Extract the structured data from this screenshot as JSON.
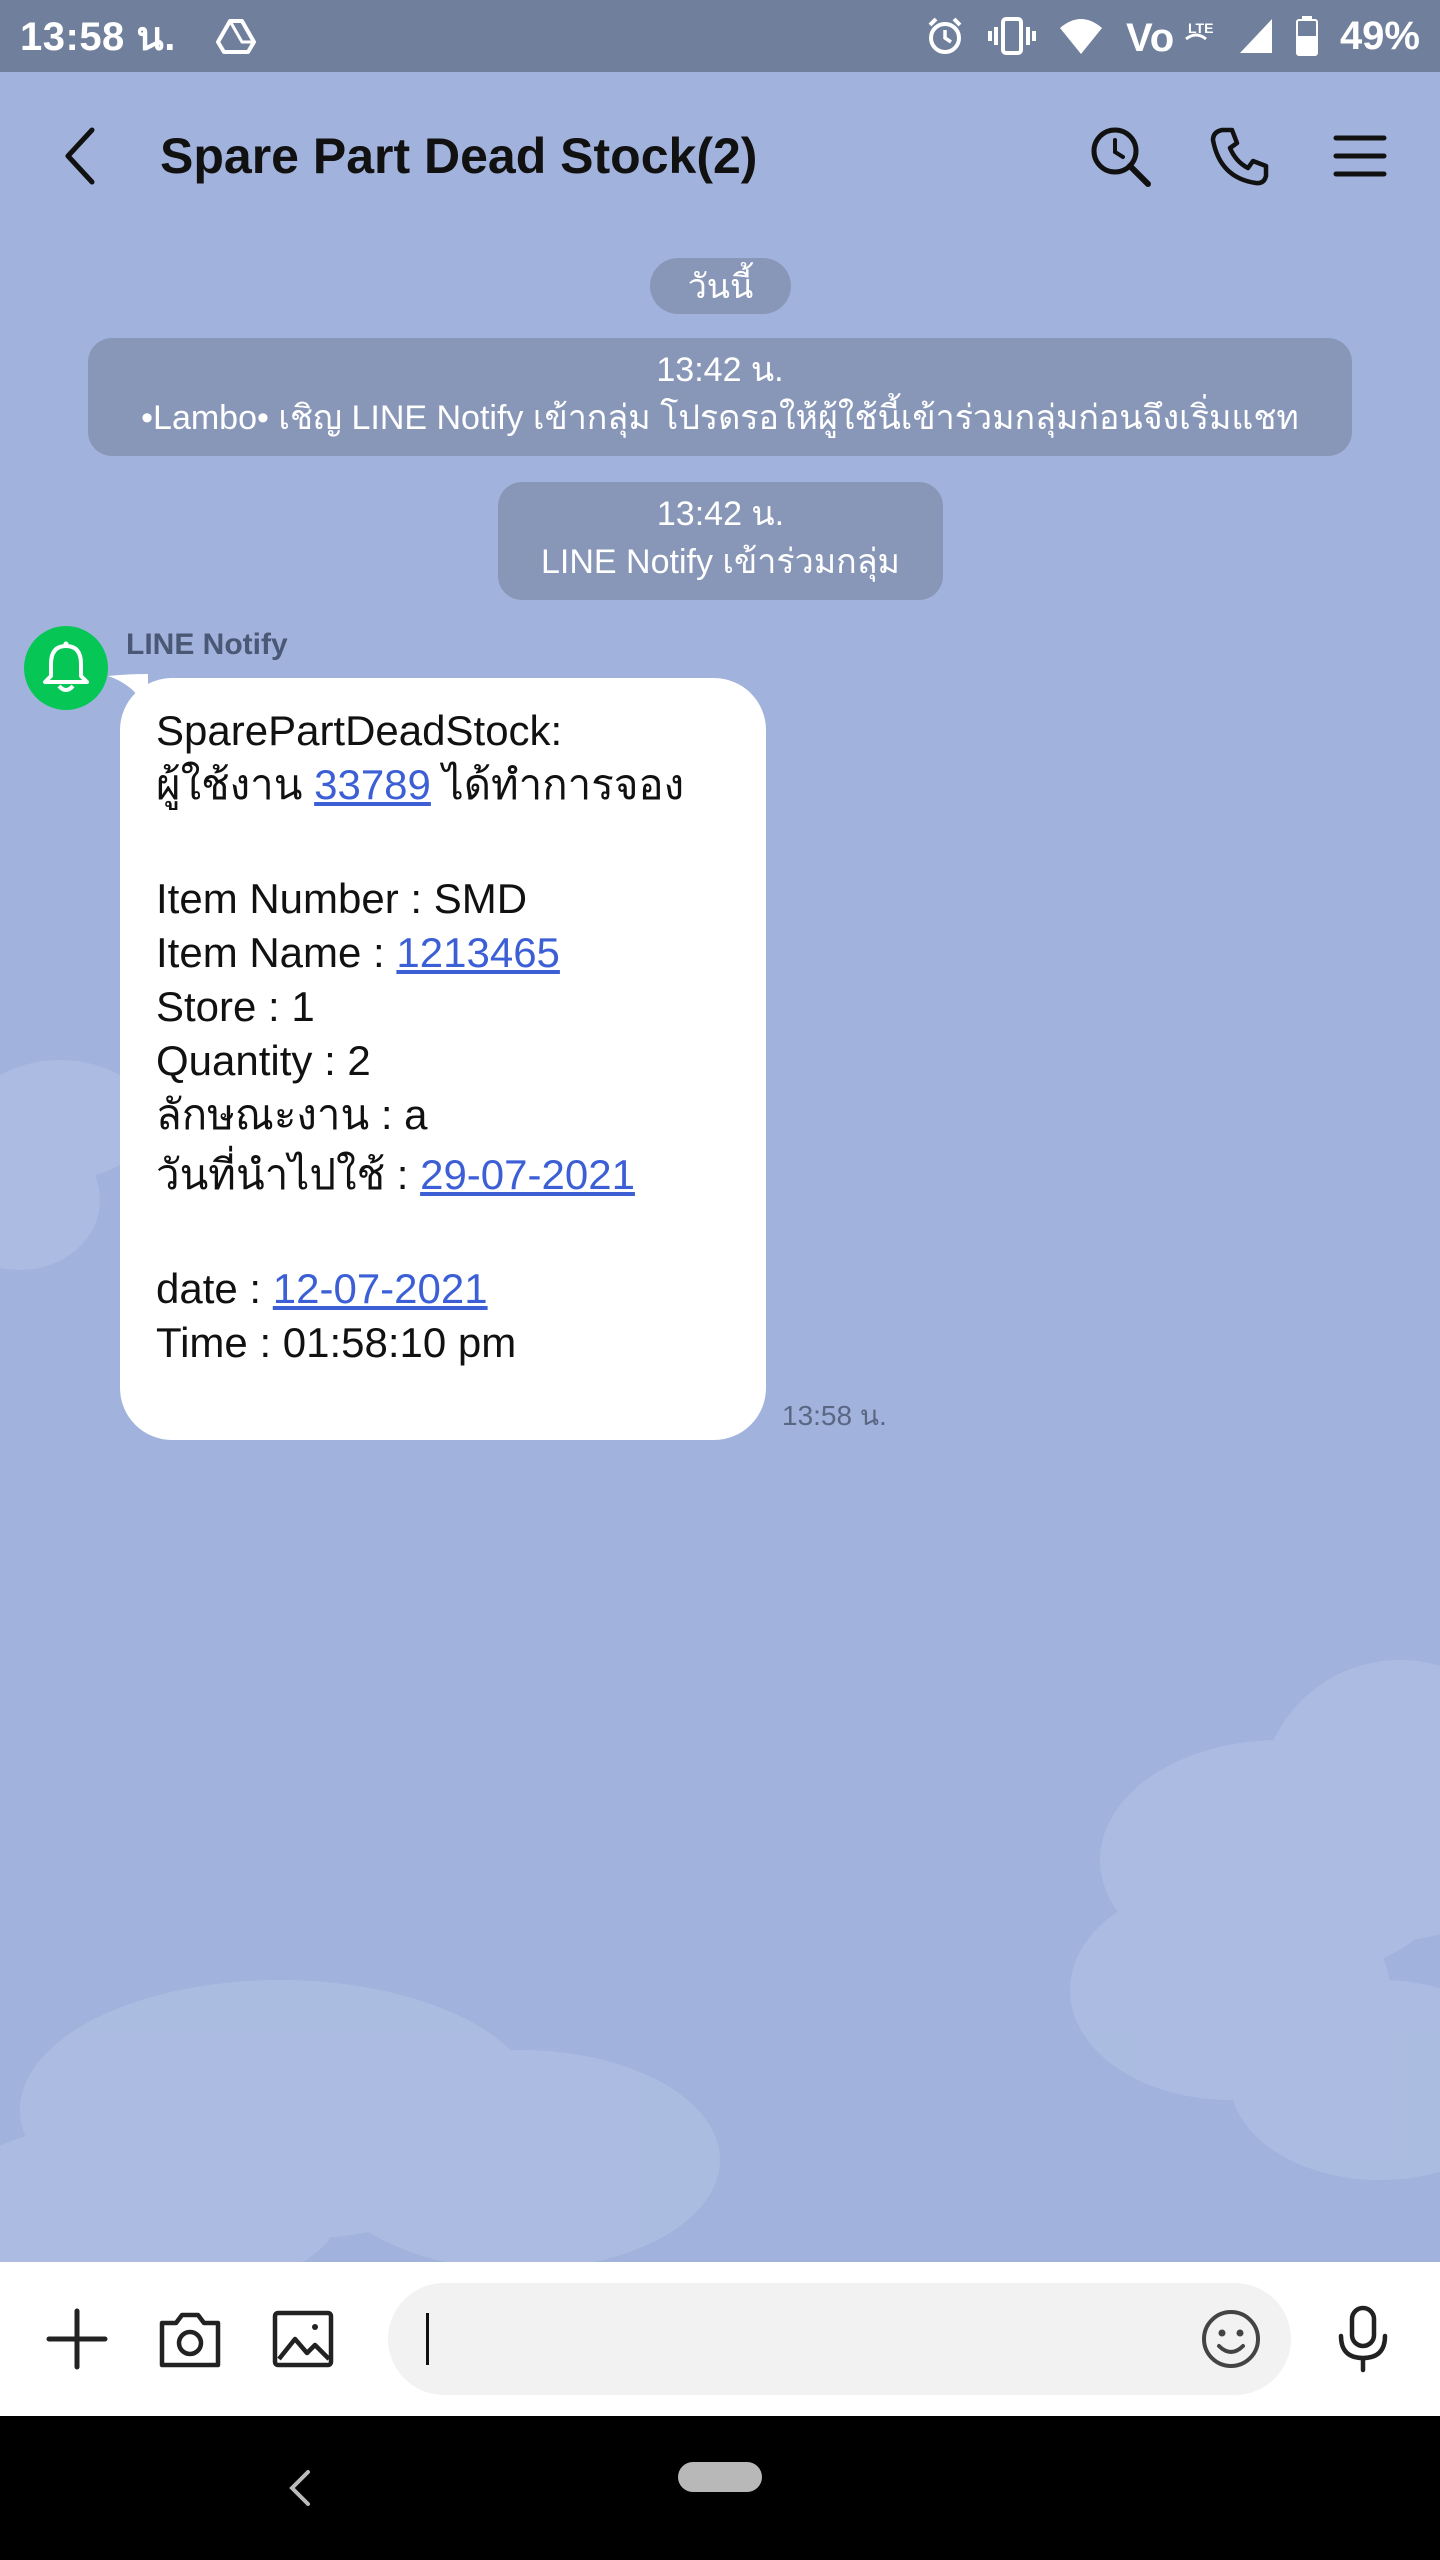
{
  "status_bar": {
    "time": "13:58 น.",
    "battery": "49%",
    "icons": [
      "drive-icon",
      "alarm-icon",
      "vibrate-icon",
      "wifi-icon",
      "volte-icon",
      "signal-icon",
      "battery-icon"
    ]
  },
  "header": {
    "title": "Spare Part Dead Stock(2)",
    "icons": [
      "back-arrow-icon",
      "search-history-icon",
      "phone-icon",
      "menu-icon"
    ]
  },
  "chat": {
    "date_label": "วันนี้",
    "system_messages": [
      {
        "time": "13:42 น.",
        "text": "•Lambo• เชิญ LINE Notify เข้ากลุ่ม โปรดรอให้ผู้ใช้นี้เข้าร่วมกลุ่มก่อนจึงเริ่มแชท"
      },
      {
        "time": "13:42 น.",
        "text": "LINE Notify เข้าร่วมกลุ่ม"
      }
    ],
    "message": {
      "sender": "LINE Notify",
      "avatar_icon": "bell-icon",
      "line1": "SparePartDeadStock:",
      "line2_prefix": "ผู้ใช้งาน ",
      "line2_link": "33789",
      "line2_suffix": " ได้ทำการจอง",
      "item_number": "Item Number : SMD",
      "item_name_prefix": "Item Name : ",
      "item_name_link": "1213465",
      "store": "Store : 1",
      "quantity": "Quantity : 2",
      "job_type": "ลักษณะงาน : a",
      "use_date_prefix": "วันที่นำไปใช้ : ",
      "use_date_link": "29-07-2021",
      "date_prefix": "date : ",
      "date_link": "12-07-2021",
      "time_line": "Time : 01:58:10 pm",
      "sent_time": "13:58 น."
    }
  },
  "input_bar": {
    "value": "",
    "icons": [
      "plus-icon",
      "camera-icon",
      "image-icon",
      "emoji-icon",
      "microphone-icon"
    ]
  },
  "colors": {
    "background": "#a1b3dc",
    "status_bar": "#6f7f9c",
    "system_pill": "#8897b8",
    "link": "#3c5fd6",
    "avatar": "#06c755"
  }
}
